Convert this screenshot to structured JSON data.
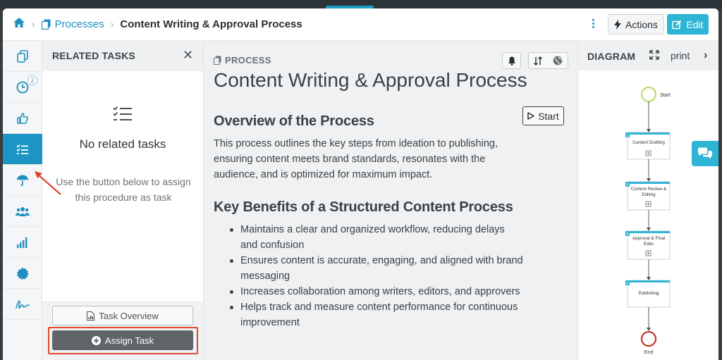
{
  "breadcrumbs": {
    "home_icon": "home-icon",
    "items": [
      {
        "label": "Processes",
        "icon": "documents-icon"
      }
    ],
    "current": "Content Writing & Approval Process"
  },
  "toolbar": {
    "actions_label": "Actions",
    "edit_label": "Edit"
  },
  "icon_nav": [
    {
      "icon": "documents-icon",
      "active": false
    },
    {
      "icon": "clock-icon",
      "badge": "2",
      "active": false
    },
    {
      "icon": "thumbs-up-icon",
      "active": false
    },
    {
      "icon": "task-list-icon",
      "active": true
    },
    {
      "icon": "umbrella-icon",
      "active": false
    },
    {
      "icon": "users-icon",
      "active": false
    },
    {
      "icon": "signal-bars-icon",
      "active": false
    },
    {
      "icon": "badge-icon",
      "active": false
    },
    {
      "icon": "signature-icon",
      "active": false
    }
  ],
  "related_tasks": {
    "title": "RELATED TASKS",
    "empty_title": "No related tasks",
    "empty_desc": "Use the button below to assign this procedure as task",
    "overview_label": "Task Overview",
    "assign_label": "Assign Task"
  },
  "main": {
    "type_label": "PROCESS",
    "title": "Content Writing & Approval Process",
    "start_label": "Start",
    "overview_heading": "Overview of the Process",
    "overview_text": "This process outlines the key steps from ideation to publishing, ensuring content meets brand standards, resonates with the audience, and is optimized for maximum impact.",
    "benefits_heading": "Key Benefits of a Structured Content Process",
    "benefits": [
      "Maintains a clear and organized workflow, reducing delays and confusion",
      "Ensures content is accurate, engaging, and aligned with brand messaging",
      "Increases collaboration among writers, editors, and approvers",
      "Helps track and measure content performance for continuous improvement"
    ]
  },
  "diagram": {
    "title": "DIAGRAM",
    "print_label": "print",
    "start_label": "Start",
    "end_label": "End",
    "steps": [
      {
        "number": "1",
        "label": "Content Drafting"
      },
      {
        "number": "2",
        "label": "Content Review & Editing"
      },
      {
        "number": "3",
        "label": "Approval & Final Edits"
      },
      {
        "number": "4",
        "label": "Publishing"
      }
    ]
  },
  "colors": {
    "accent": "#1c95c4",
    "highlight_outline": "#e0462d",
    "start_node": "#b7d95b",
    "end_node": "#c0392b"
  }
}
